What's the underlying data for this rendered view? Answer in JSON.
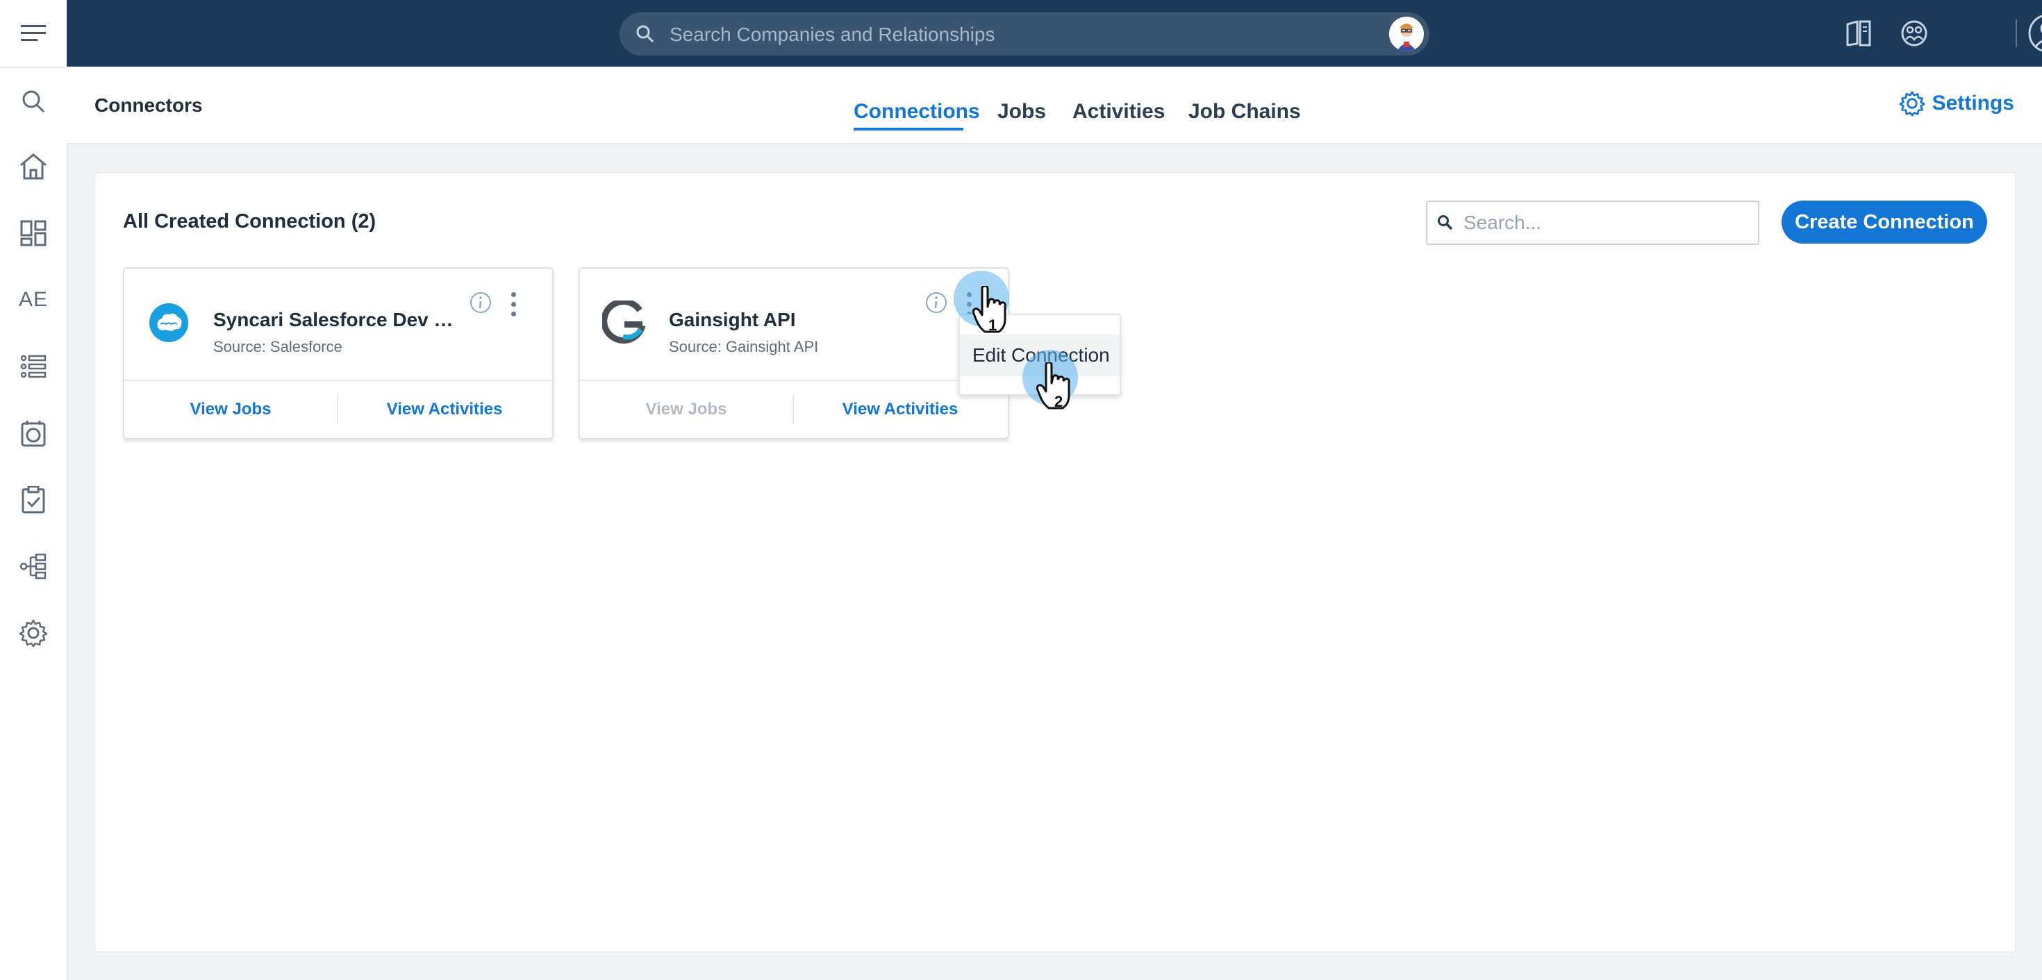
{
  "sidebar": {
    "items": [
      {
        "icon": "search-icon"
      },
      {
        "icon": "home-icon"
      },
      {
        "icon": "dashboard-grid-icon"
      },
      {
        "icon": "text-icon",
        "label": "AE"
      },
      {
        "icon": "list-icon"
      },
      {
        "icon": "timeline-icon"
      },
      {
        "icon": "clipboard-check-icon"
      },
      {
        "icon": "hierarchy-icon"
      },
      {
        "icon": "gear-icon"
      }
    ]
  },
  "topbar": {
    "search_placeholder": "Search Companies and Relationships",
    "icons": [
      "book-icon",
      "network-globe-icon",
      "user-profile-icon"
    ]
  },
  "page": {
    "title": "Connectors",
    "tabs": [
      {
        "label": "Connections",
        "active": true
      },
      {
        "label": "Jobs",
        "active": false
      },
      {
        "label": "Activities",
        "active": false
      },
      {
        "label": "Job Chains",
        "active": false
      }
    ],
    "settings_label": "Settings"
  },
  "panel": {
    "heading": "All Created Connection (2)",
    "search_placeholder": "Search...",
    "create_button": "Create Connection",
    "cards": [
      {
        "name": "Syncari Salesforce Dev Con...",
        "source": "Source: Salesforce",
        "logo": "salesforce-logo",
        "view_jobs": "View Jobs",
        "view_activities": "View Activities",
        "view_jobs_enabled": true
      },
      {
        "name": "Gainsight API",
        "source": "Source: Gainsight API",
        "logo": "gainsight-logo",
        "view_jobs": "View Jobs",
        "view_activities": "View Activities",
        "view_jobs_enabled": false
      }
    ]
  },
  "dropdown": {
    "items": [
      "Edit Connection"
    ]
  },
  "click_steps": [
    "1",
    "2"
  ],
  "colors": {
    "topbar": "#1b3a5c",
    "accent": "#1476d4",
    "disabled": "#b3bac3"
  }
}
